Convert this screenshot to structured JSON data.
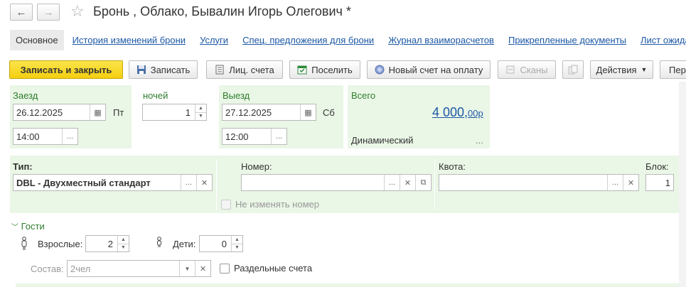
{
  "header": {
    "back_glyph": "←",
    "forward_glyph": "→",
    "title": "Бронь , Облако, Бывалин Игорь Олегович *"
  },
  "tabs": [
    {
      "label": "Основное",
      "active": true
    },
    {
      "label": "История изменений брони"
    },
    {
      "label": "Услуги"
    },
    {
      "label": "Спец. предложения для брони"
    },
    {
      "label": "Журнал взаиморасчетов"
    },
    {
      "label": "Прикрепленные документы"
    },
    {
      "label": "Лист ожидан"
    }
  ],
  "toolbar": {
    "save_close": "Записать и закрыть",
    "save": "Записать",
    "accounts": "Лиц. счета",
    "checkin": "Поселить",
    "new_invoice": "Новый счет на оплату",
    "scans": "Сканы",
    "actions": "Действия",
    "more": "Пер"
  },
  "stay": {
    "checkin_label": "Заезд",
    "checkin_date": "26.12.2025",
    "checkin_weekday": "Пт",
    "checkin_time": "14:00",
    "nights_label": "ночей",
    "nights": "1",
    "checkout_label": "Выезд",
    "checkout_date": "27.12.2025",
    "checkout_weekday": "Сб",
    "checkout_time": "12:00",
    "total_label": "Всего",
    "total_amount": "4 000,",
    "total_cents": "00р",
    "pricing_label": "Динамический",
    "pricing_more": "..."
  },
  "room": {
    "type_label": "Тип:",
    "type_value": "DBL - Двухместный стандарт",
    "number_label": "Номер:",
    "number_value": "",
    "keep_number_label": "Не изменять номер",
    "quota_label": "Квота:",
    "quota_value": "",
    "block_label": "Блок:",
    "block_value": "1"
  },
  "guests": {
    "section_label": "Гости",
    "adults_label": "Взрослые:",
    "adults": "2",
    "children_label": "Дети:",
    "children": "0",
    "composition_label": "Состав:",
    "composition_value": "2чел",
    "separate_accounts_label": "Раздельные счета"
  },
  "colors": {
    "panel_bg": "#eaf6e6",
    "link": "#1c58a5",
    "primary_button": "#f4cf10",
    "section_green": "#2d7d2d"
  }
}
